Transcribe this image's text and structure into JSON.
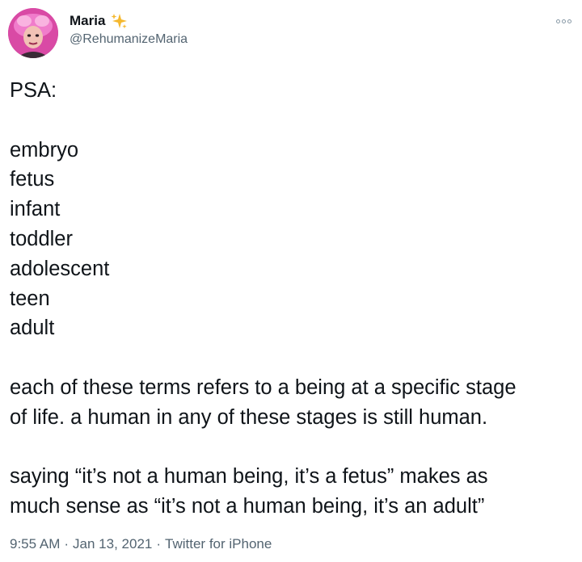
{
  "author": {
    "display_name": "Maria",
    "name_emoji": "sparkles-icon",
    "handle": "@RehumanizeMaria"
  },
  "tweet": {
    "lines": [
      "PSA:",
      "",
      "embryo",
      "fetus",
      "infant",
      "toddler",
      "adolescent",
      "teen",
      "adult",
      "",
      "each of these terms refers to a being at a specific stage",
      "of life. a human in any of these stages is still human.",
      "",
      "saying “it’s not a human being, it’s a fetus” makes as",
      "much sense as “it’s not a human being, it’s an adult”"
    ],
    "time": "9:55 AM",
    "separator": "·",
    "date": "Jan 13, 2021",
    "source": "Twitter for iPhone"
  },
  "colors": {
    "text": "#0f1419",
    "secondary": "#536471",
    "sparkle": "#f5b82e"
  }
}
